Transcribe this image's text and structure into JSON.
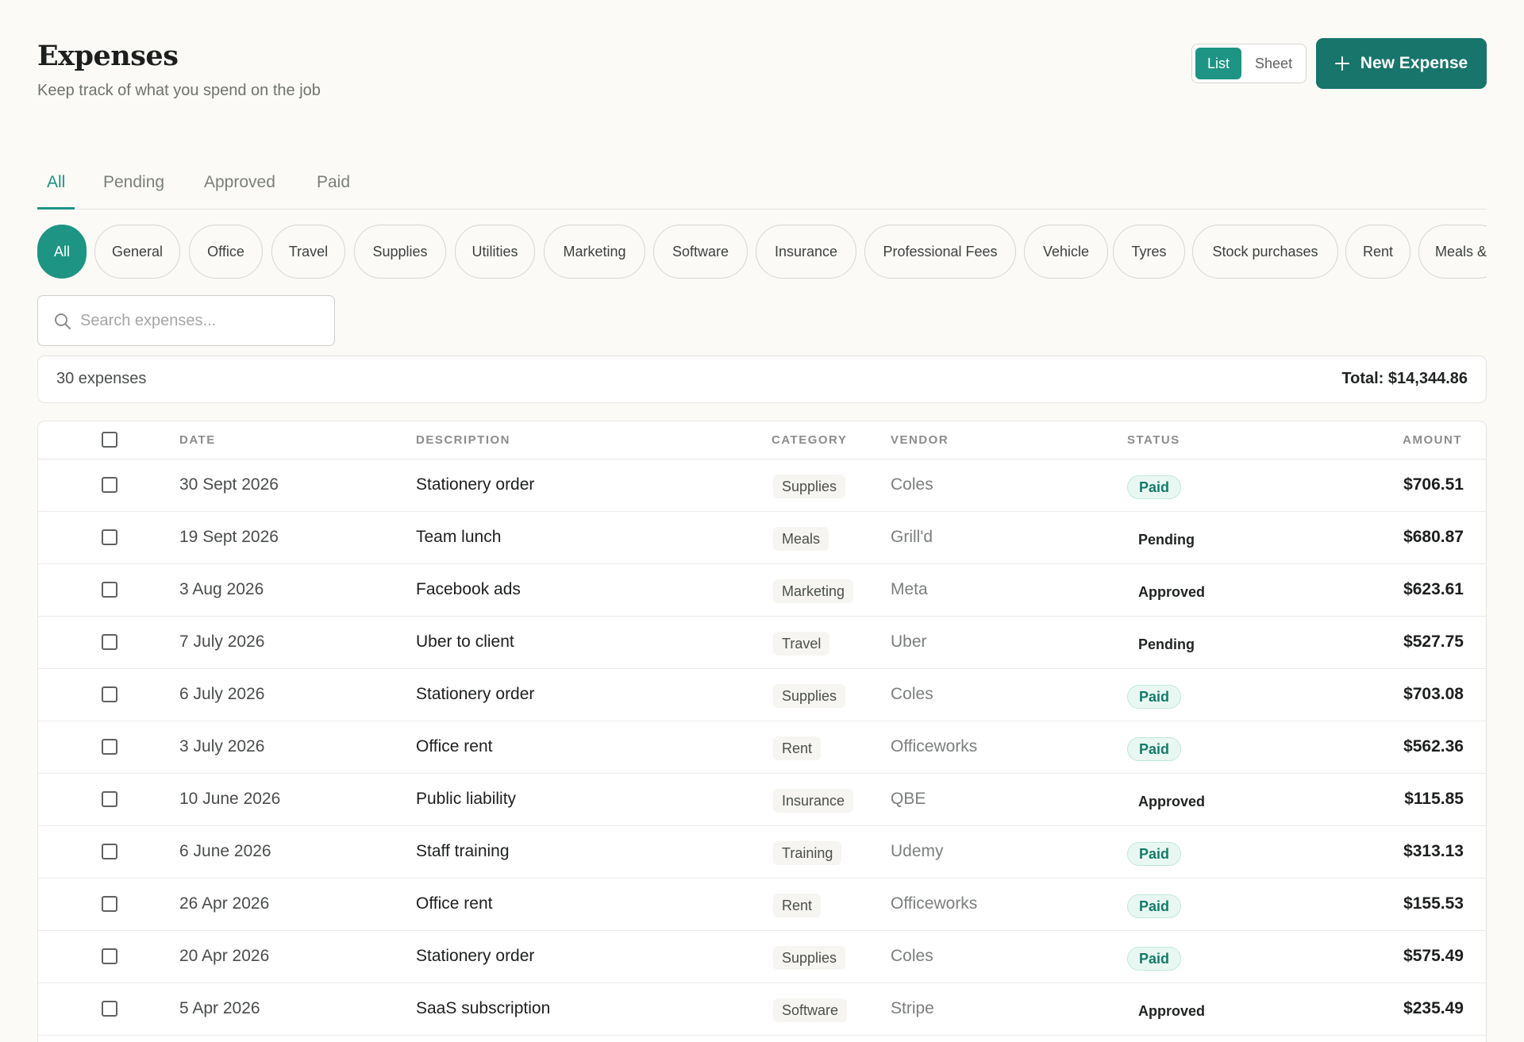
{
  "header": {
    "title": "Expenses",
    "subtitle": "Keep track of what you spend on the job",
    "view_toggle": {
      "list_label": "List",
      "sheet_label": "Sheet",
      "selected": "List"
    },
    "new_button_label": "New Expense"
  },
  "tabs": [
    {
      "label": "All",
      "active": true
    },
    {
      "label": "Pending",
      "active": false
    },
    {
      "label": "Approved",
      "active": false
    },
    {
      "label": "Paid",
      "active": false
    }
  ],
  "categories": [
    {
      "label": "All",
      "active": true
    },
    {
      "label": "General"
    },
    {
      "label": "Office"
    },
    {
      "label": "Travel"
    },
    {
      "label": "Supplies"
    },
    {
      "label": "Utilities"
    },
    {
      "label": "Marketing"
    },
    {
      "label": "Software"
    },
    {
      "label": "Insurance"
    },
    {
      "label": "Professional Fees"
    },
    {
      "label": "Vehicle"
    },
    {
      "label": "Tyres"
    },
    {
      "label": "Stock purchases"
    },
    {
      "label": "Rent"
    },
    {
      "label": "Meals &"
    }
  ],
  "search": {
    "placeholder": "Search expenses...",
    "value": ""
  },
  "summary": {
    "count_text": "30 expenses",
    "total_text": "Total: $14,344.86"
  },
  "table": {
    "columns": {
      "date": "DATE",
      "description": "DESCRIPTION",
      "category": "CATEGORY",
      "vendor": "VENDOR",
      "status": "STATUS",
      "amount": "AMOUNT"
    },
    "rows": [
      {
        "date": "30 Sept 2026",
        "description": "Stationery order",
        "category": "Supplies",
        "vendor": "Coles",
        "status": "Paid",
        "amount": "$706.51"
      },
      {
        "date": "19 Sept 2026",
        "description": "Team lunch",
        "category": "Meals",
        "vendor": "Grill'd",
        "status": "Pending",
        "amount": "$680.87"
      },
      {
        "date": "3 Aug 2026",
        "description": "Facebook ads",
        "category": "Marketing",
        "vendor": "Meta",
        "status": "Approved",
        "amount": "$623.61"
      },
      {
        "date": "7 July 2026",
        "description": "Uber to client",
        "category": "Travel",
        "vendor": "Uber",
        "status": "Pending",
        "amount": "$527.75"
      },
      {
        "date": "6 July 2026",
        "description": "Stationery order",
        "category": "Supplies",
        "vendor": "Coles",
        "status": "Paid",
        "amount": "$703.08"
      },
      {
        "date": "3 July 2026",
        "description": "Office rent",
        "category": "Rent",
        "vendor": "Officeworks",
        "status": "Paid",
        "amount": "$562.36"
      },
      {
        "date": "10 June 2026",
        "description": "Public liability",
        "category": "Insurance",
        "vendor": "QBE",
        "status": "Approved",
        "amount": "$115.85"
      },
      {
        "date": "6 June 2026",
        "description": "Staff training",
        "category": "Training",
        "vendor": "Udemy",
        "status": "Paid",
        "amount": "$313.13"
      },
      {
        "date": "26 Apr 2026",
        "description": "Office rent",
        "category": "Rent",
        "vendor": "Officeworks",
        "status": "Paid",
        "amount": "$155.53"
      },
      {
        "date": "20 Apr 2026",
        "description": "Stationery order",
        "category": "Supplies",
        "vendor": "Coles",
        "status": "Paid",
        "amount": "$575.49"
      },
      {
        "date": "5 Apr 2026",
        "description": "SaaS subscription",
        "category": "Software",
        "vendor": "Stripe",
        "status": "Approved",
        "amount": "$235.49"
      }
    ]
  },
  "colors": {
    "accent": "#1d9484",
    "primary_button": "#17756b",
    "paid_text": "#127c69",
    "paid_bg": "#e9f7f2"
  }
}
